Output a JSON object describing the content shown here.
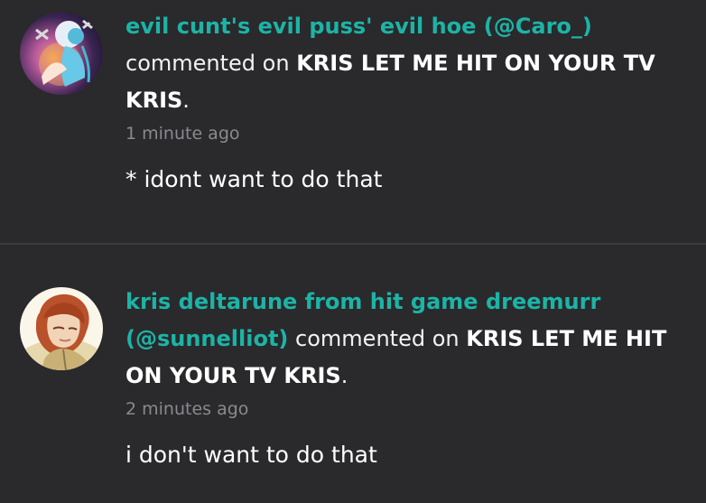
{
  "feed": {
    "items": [
      {
        "user_display": "evil cunt's evil puss' evil hoe (@Caro_)",
        "action": "commented on",
        "post_title": "KRIS LET ME HIT ON YOUR TV KRIS",
        "punctuation": ".",
        "timestamp": "1 minute ago",
        "comment": "* idont want to do that",
        "avatar_icon": "avatar-icon"
      },
      {
        "user_display": "kris deltarune from hit game dreemurr (@sunnelliot)",
        "action": "commented on",
        "post_title": "KRIS LET ME HIT ON YOUR TV KRIS",
        "punctuation": ".",
        "timestamp": "2 minutes ago",
        "comment": "i don't want to do that",
        "avatar_icon": "avatar-icon"
      }
    ]
  },
  "colors": {
    "background": "#2a292c",
    "divider": "#3b3a3d",
    "username": "#1cb4a6",
    "timestamp": "#8a898d",
    "text": "#ffffff"
  }
}
